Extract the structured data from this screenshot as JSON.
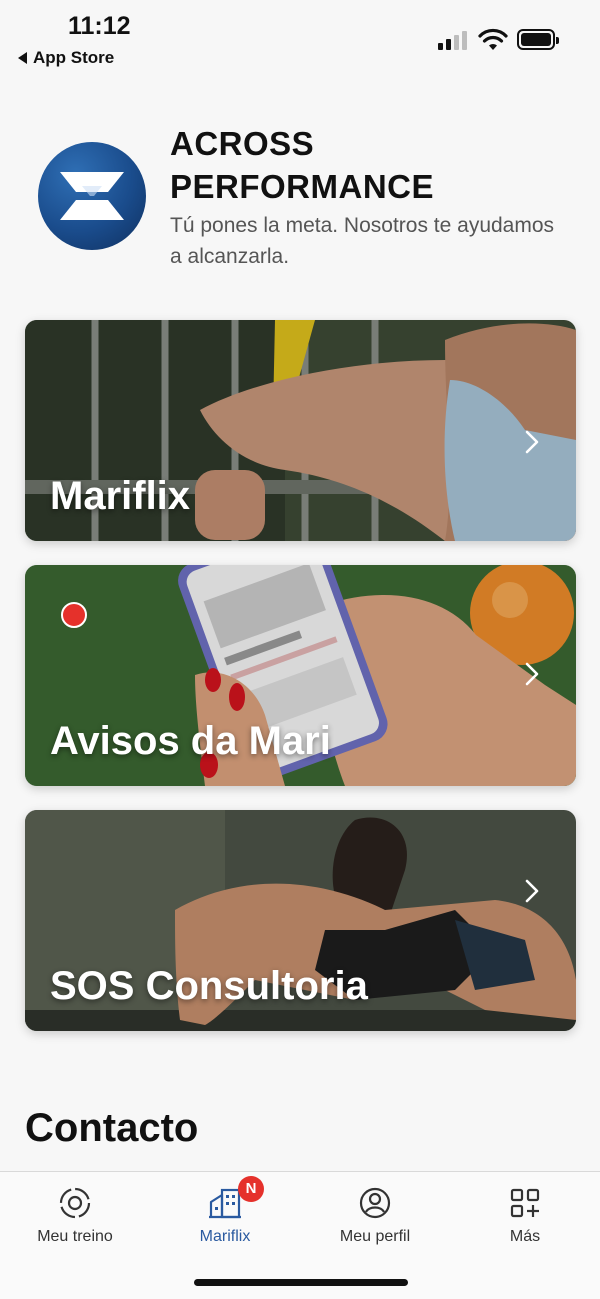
{
  "status_bar": {
    "time": "11:12",
    "back_label": "App Store"
  },
  "header": {
    "brand_name": "ACROSS PERFORMANCE",
    "tagline": "Tú pones la meta. Nosotros te ayudamos a alcanzarla.",
    "logo_icon": "across-performance-logo"
  },
  "cards": [
    {
      "label": "Mariflix"
    },
    {
      "label": "Avisos da Mari",
      "has_notification": true
    },
    {
      "label": "SOS Consultoria"
    }
  ],
  "contact": {
    "heading": "Contacto"
  },
  "tab_bar": {
    "tabs": [
      {
        "label": "Meu treino",
        "icon": "target-icon",
        "active": false
      },
      {
        "label": "Mariflix",
        "icon": "buildings-icon",
        "active": true,
        "badge": "N"
      },
      {
        "label": "Meu perfil",
        "icon": "profile-icon",
        "active": false
      },
      {
        "label": "Más",
        "icon": "grid-plus-icon",
        "active": false
      }
    ]
  },
  "colors": {
    "accent": "#2a5aa0",
    "notification": "#e5312b"
  }
}
